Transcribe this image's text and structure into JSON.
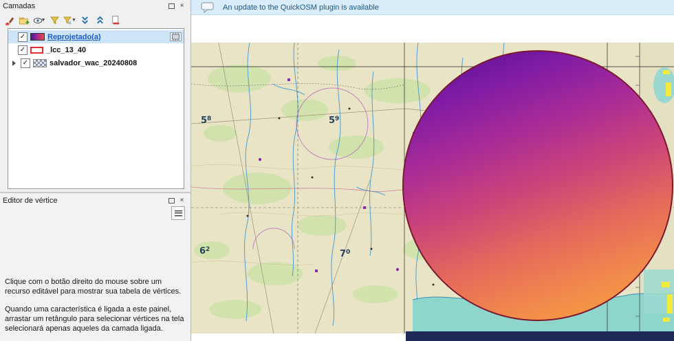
{
  "ui": {
    "close_glyph": "×",
    "check_glyph": "✓"
  },
  "layers_panel": {
    "title": "Camadas",
    "toolbar_icons": [
      "layer-styling-icon",
      "add-group-icon",
      "manage-map-themes-icon",
      "filter-legend-icon",
      "filter-expression-icon",
      "expand-all-icon",
      "collapse-all-icon",
      "remove-layer-icon"
    ],
    "layers": [
      {
        "label": "Reprojetado(a)",
        "checked": true,
        "selected": true,
        "indicator": "memory-layer-indicator"
      },
      {
        "label": "_lcc_13_40",
        "checked": true,
        "selected": false
      },
      {
        "label": "salvador_wac_20240808",
        "checked": true,
        "selected": false,
        "expandable": true
      }
    ]
  },
  "vertex_editor": {
    "title": "Editor de vértice",
    "hint1": "Clique com o botão direito do mouse sobre um recurso editável para mostrar sua tabela de vértices.",
    "hint2": "Quando uma característica é ligada a este painel, arrastar um retângulo para selecionar vértices na tela selecionará apenas aqueles da camada ligada."
  },
  "message_bar": {
    "text": "An update to the QuickOSM plugin is available"
  },
  "map": {
    "figures": [
      {
        "big": "5",
        "small": "8"
      },
      {
        "big": "5",
        "small": "9"
      },
      {
        "big": "6",
        "small": "2"
      },
      {
        "big": "7",
        "small": "0"
      }
    ],
    "circle_gradient_angle": 160,
    "circle_gradient": [
      "#4f0d8c",
      "#7e1ba5",
      "#a82b97",
      "#cc4479",
      "#e56a5b",
      "#f28b4b",
      "#f9a73d"
    ],
    "circle_border": "#7b1a2e",
    "colors": {
      "land": "#e9e4c6",
      "water": "#8ed6cc",
      "vegetation": "#cfe2ab"
    }
  }
}
